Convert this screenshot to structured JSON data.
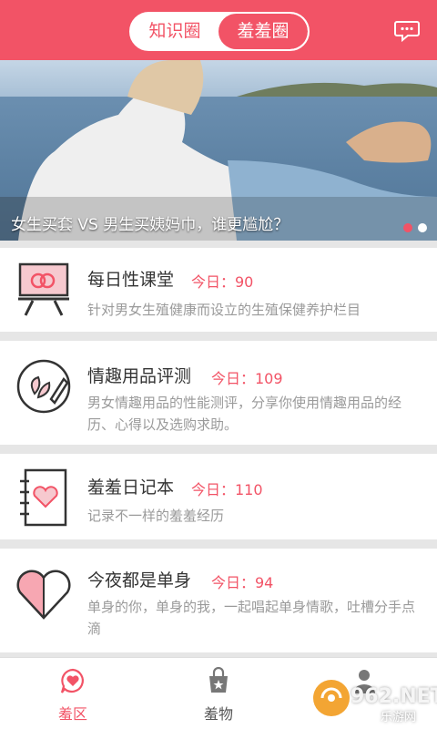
{
  "header": {
    "tabs": [
      {
        "label": "知识圈",
        "active": false
      },
      {
        "label": "羞羞圈",
        "active": true
      }
    ],
    "chat_icon": "chat-bubble-icon",
    "accent": "#f25366"
  },
  "banner": {
    "caption": "女生买套 VS 男生买姨妈巾，谁更尴尬？",
    "slides": 2,
    "active_slide": 1
  },
  "cards": [
    {
      "icon": "classroom-board-icon",
      "title": "每日性课堂",
      "count": "今日：90",
      "desc": "针对男女生殖健康而设立的生殖保健养护栏目"
    },
    {
      "icon": "pencil-leaf-icon",
      "title": "情趣用品评测",
      "count": "今日：109",
      "desc": "男女情趣用品的性能测评，分享你使用情趣用品的经历、心得以及选购求助。"
    },
    {
      "icon": "heart-notebook-icon",
      "title": "羞羞日记本",
      "count": "今日：110",
      "desc": "记录不一样的羞羞经历"
    },
    {
      "icon": "half-heart-icon",
      "title": "今夜都是单身",
      "count": "今日：94",
      "desc": "单身的你，单身的我，一起唱起单身情歌，吐槽分手点滴"
    }
  ],
  "tabbar": [
    {
      "label": "羞区",
      "icon": "heart-bubble-icon",
      "active": true
    },
    {
      "label": "羞物",
      "icon": "shopping-bag-icon",
      "active": false
    },
    {
      "label": "",
      "icon": "person-icon",
      "active": false
    }
  ],
  "watermark": {
    "main": "962.NET",
    "sub": "乐游网"
  }
}
